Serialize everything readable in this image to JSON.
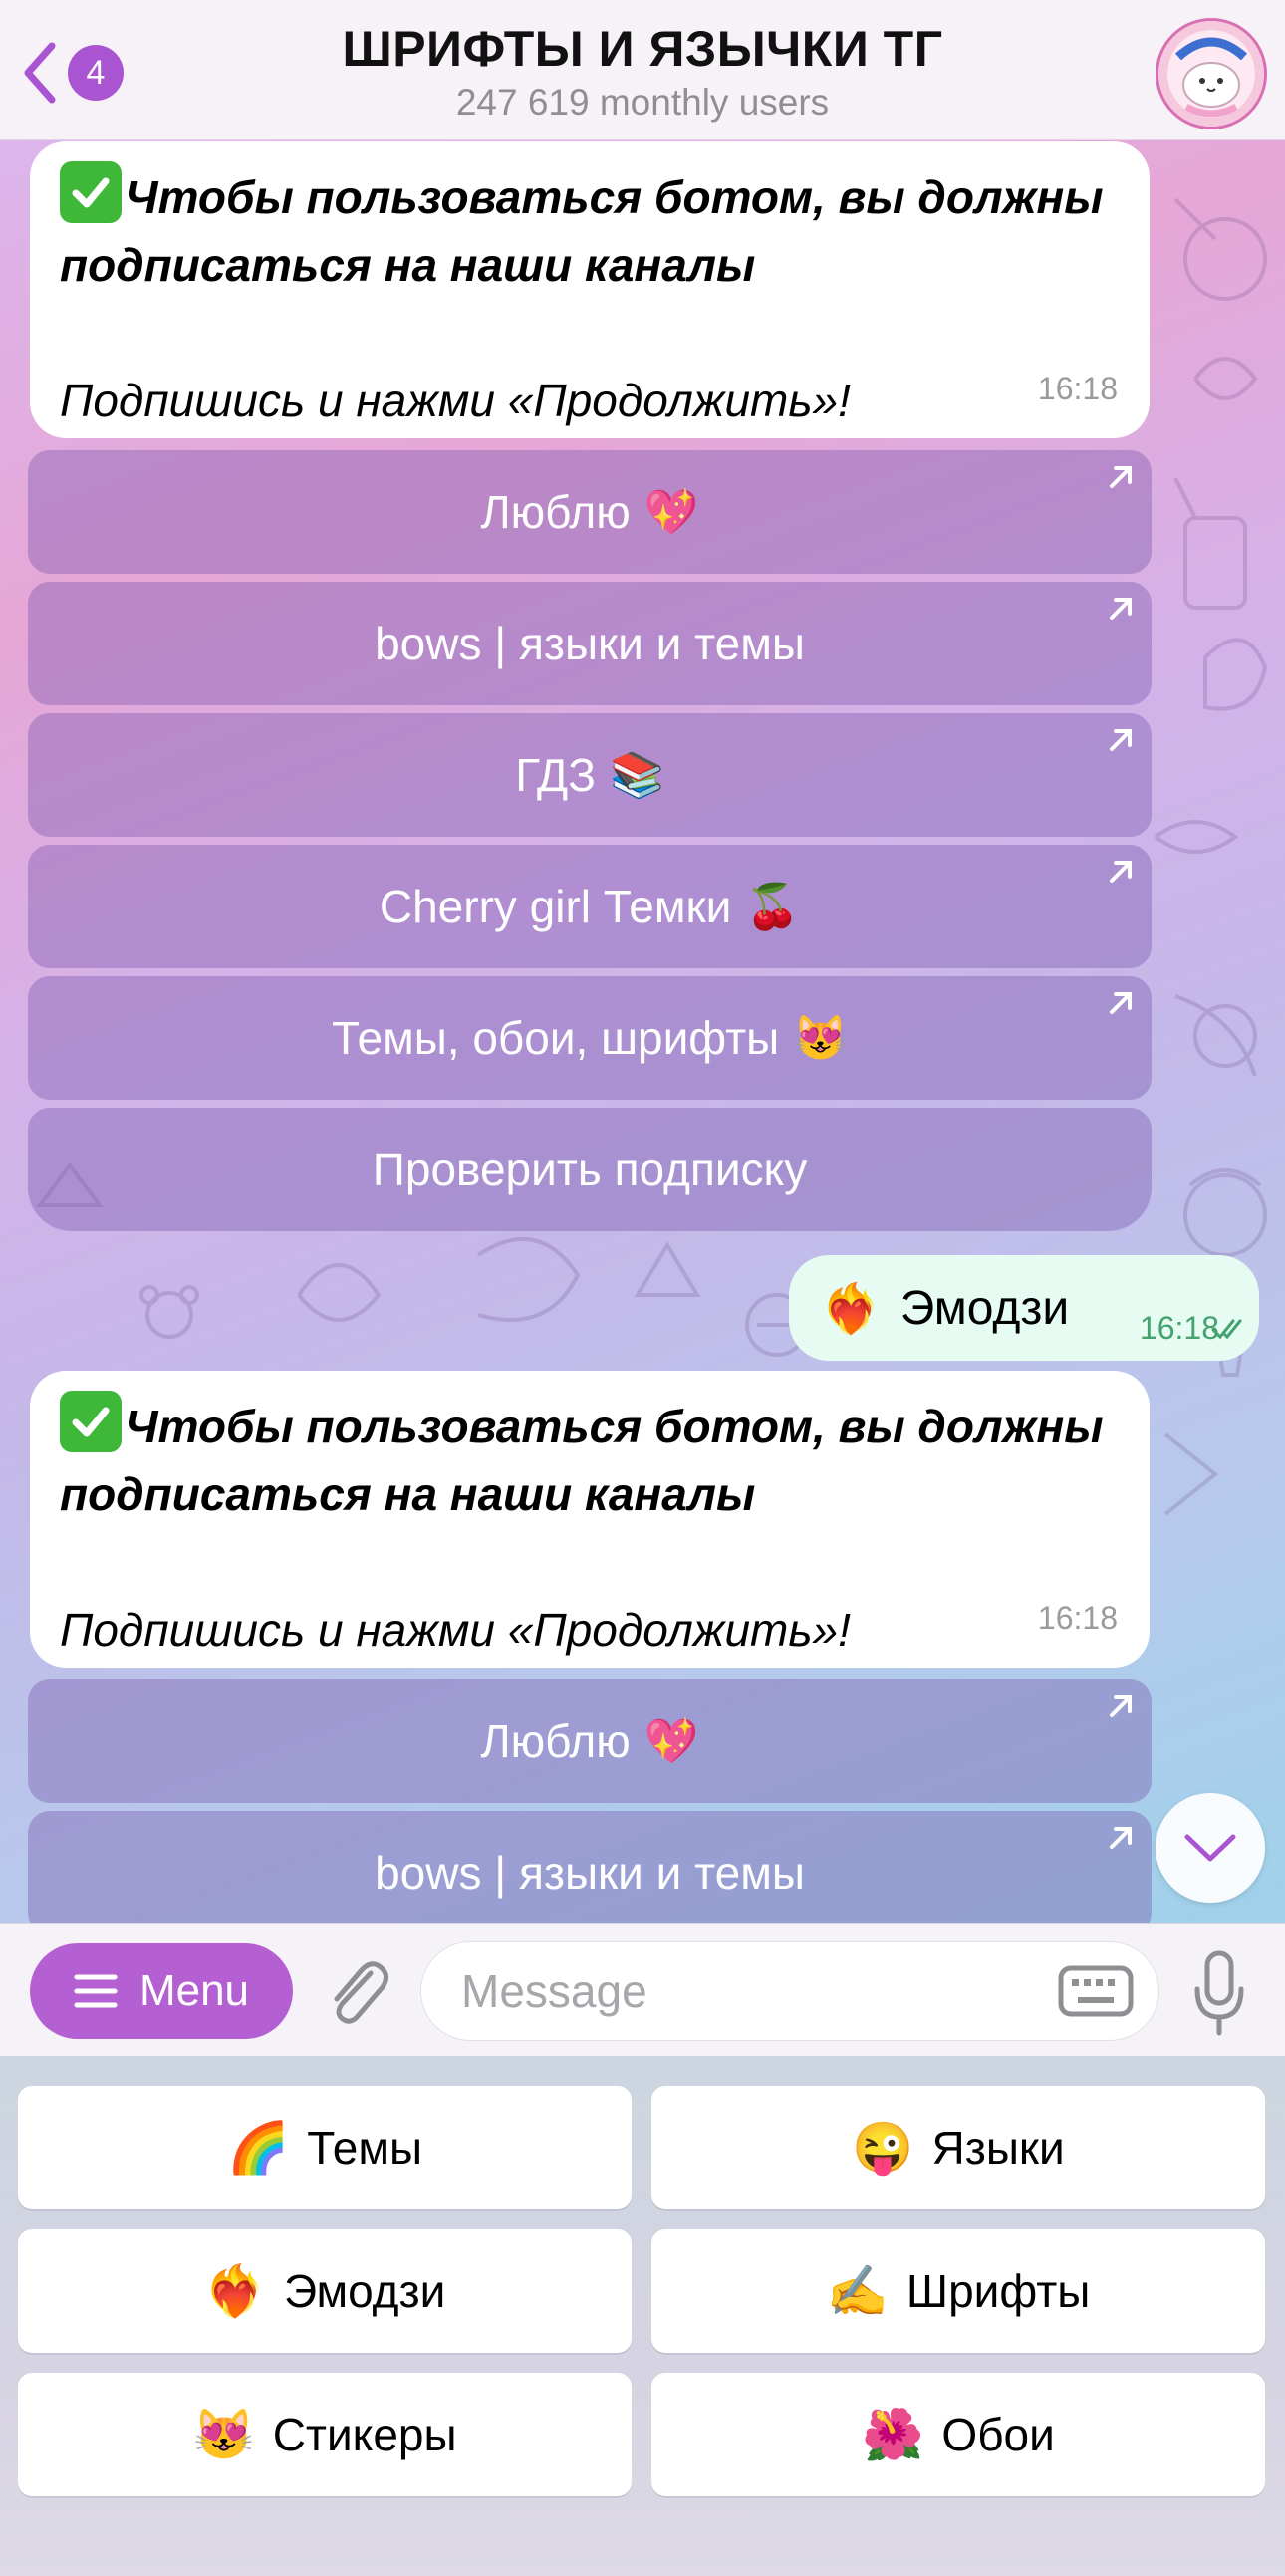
{
  "header": {
    "back_badge": "4",
    "title": "ШРИФТЫ И ЯЗЫЧКИ ТГ",
    "subtitle": "247 619 monthly users"
  },
  "messages": [
    {
      "bold_text": "Чтобы пользоваться ботом, вы должны подписаться на наши каналы",
      "italic_text": "Подпишись и нажми «Продолжить»!",
      "time": "16:18",
      "buttons": [
        {
          "label": "Люблю",
          "emoji": "💖",
          "external": true
        },
        {
          "label": "bows | языки и темы",
          "emoji": "",
          "external": true
        },
        {
          "label": "ГДЗ",
          "emoji": "📚",
          "external": true
        },
        {
          "label": "Cherry girl Темки",
          "emoji": "🍒",
          "external": true
        },
        {
          "label": "Темы, обои, шрифты",
          "emoji": "😻",
          "external": true
        },
        {
          "label": "Проверить подписку",
          "emoji": "",
          "external": false
        }
      ]
    },
    {
      "bold_text": "Чтобы пользоваться ботом, вы должны подписаться на наши каналы",
      "italic_text": "Подпишись и нажми «Продолжить»!",
      "time": "16:18",
      "buttons": [
        {
          "label": "Люблю",
          "emoji": "💖",
          "external": true
        },
        {
          "label": "bows | языки и темы",
          "emoji": "",
          "external": true
        }
      ]
    }
  ],
  "outgoing": {
    "emoji": "❤️‍🔥",
    "text": "Эмодзи",
    "time": "16:18"
  },
  "input": {
    "menu_label": "Menu",
    "placeholder": "Message",
    "value": ""
  },
  "keyboard": [
    {
      "emoji": "🌈",
      "label": "Темы"
    },
    {
      "emoji": "😜",
      "label": "Языки"
    },
    {
      "emoji": "❤️‍🔥",
      "label": "Эмодзи"
    },
    {
      "emoji": "✍️",
      "label": "Шрифты"
    },
    {
      "emoji": "😻",
      "label": "Стикеры"
    },
    {
      "emoji": "🌺",
      "label": "Обои"
    }
  ],
  "colors": {
    "accent": "#b560d2",
    "badge": "#a955d2",
    "outgoing_bubble": "#e6fbf2"
  }
}
